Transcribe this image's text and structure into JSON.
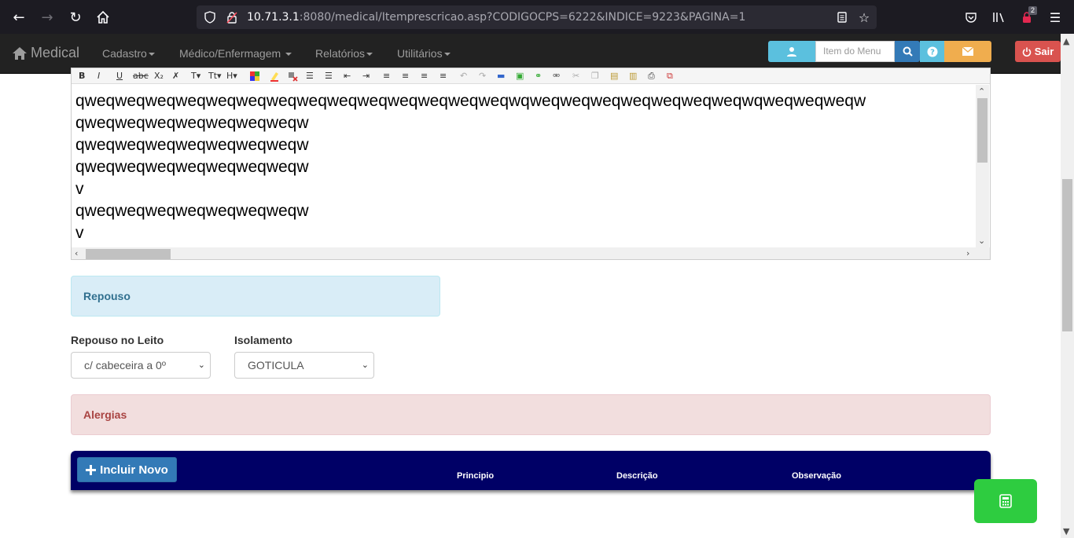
{
  "browser": {
    "url_host": "10.71.3.1",
    "url_path": ":8080/medical/Itemprescricao.asp?CODIGOCPS=6222&INDICE=9223&PAGINA=1",
    "badge_count": "2"
  },
  "navbar": {
    "brand": "Medical",
    "menus": [
      "Cadastro",
      "Médico/Enfermagem",
      "Relatórios",
      "Utilitários"
    ],
    "search_placeholder": "Item do Menu",
    "logout_label": "Sair"
  },
  "editor": {
    "lines": [
      "qweqweqweqweqweqweqweqweqweqweqweqweqweqweqwqweqweqweqweqweqweqweqwqweqweqweqw",
      "qweqweqweqweqweqweqweqw",
      "qweqweqweqweqweqweqweqw",
      "qweqweqweqweqweqweqweqw",
      "v",
      "qweqweqweqweqweqweqweqw",
      "v"
    ]
  },
  "repouso": {
    "panel_title": "Repouso",
    "leito_label": "Repouso no Leito",
    "leito_value": "c/ cabeceira a 0º",
    "isolamento_label": "Isolamento",
    "isolamento_value": "GOTICULA"
  },
  "alergias": {
    "panel_title": "Alergias",
    "add_button": "Incluir Novo",
    "columns": [
      "Principio",
      "Descrição",
      "Observação"
    ]
  },
  "colors": {
    "navbar_bg": "#222222",
    "info_bg": "#d9edf7",
    "danger_bg": "#f2dede",
    "table_header_bg": "#000066",
    "fab_bg": "#2ecc40"
  }
}
